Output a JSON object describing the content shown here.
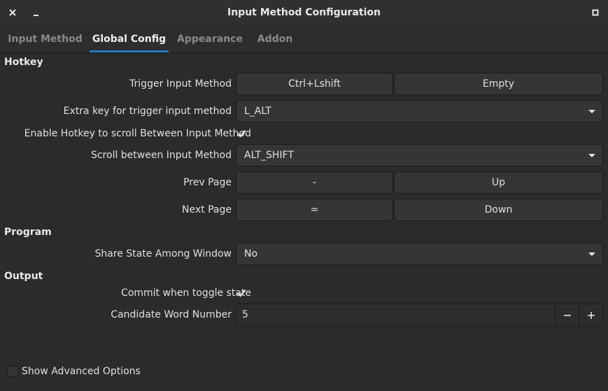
{
  "window": {
    "title": "Input Method Configuration"
  },
  "tabs": [
    "Input Method",
    "Global Config",
    "Appearance",
    "Addon"
  ],
  "sections": {
    "hotkey": "Hotkey",
    "program": "Program",
    "output": "Output"
  },
  "hotkey": {
    "trigger_label": "Trigger Input Method",
    "trigger_keys": [
      "Ctrl+Lshift",
      "Empty"
    ],
    "extra_label": "Extra key for trigger input method",
    "extra_value": "L_ALT",
    "enable_scroll_label": "Enable Hotkey to scroll Between Input Method",
    "enable_scroll_checked": true,
    "scroll_label": "Scroll between Input Method",
    "scroll_value": "ALT_SHIFT",
    "prev_label": "Prev Page",
    "prev_keys": [
      "-",
      "Up"
    ],
    "next_label": "Next Page",
    "next_keys": [
      "=",
      "Down"
    ]
  },
  "program": {
    "share_label": "Share State Among Window",
    "share_value": "No"
  },
  "output": {
    "commit_label": "Commit when toggle state",
    "commit_checked": true,
    "candidate_label": "Candidate Word Number",
    "candidate_value": "5"
  },
  "footer": {
    "advanced_label": "Show Advanced Options",
    "advanced_checked": false
  },
  "colors": {
    "accent": "#2a76c6",
    "background": "#2b2b2b",
    "button": "#353535"
  }
}
